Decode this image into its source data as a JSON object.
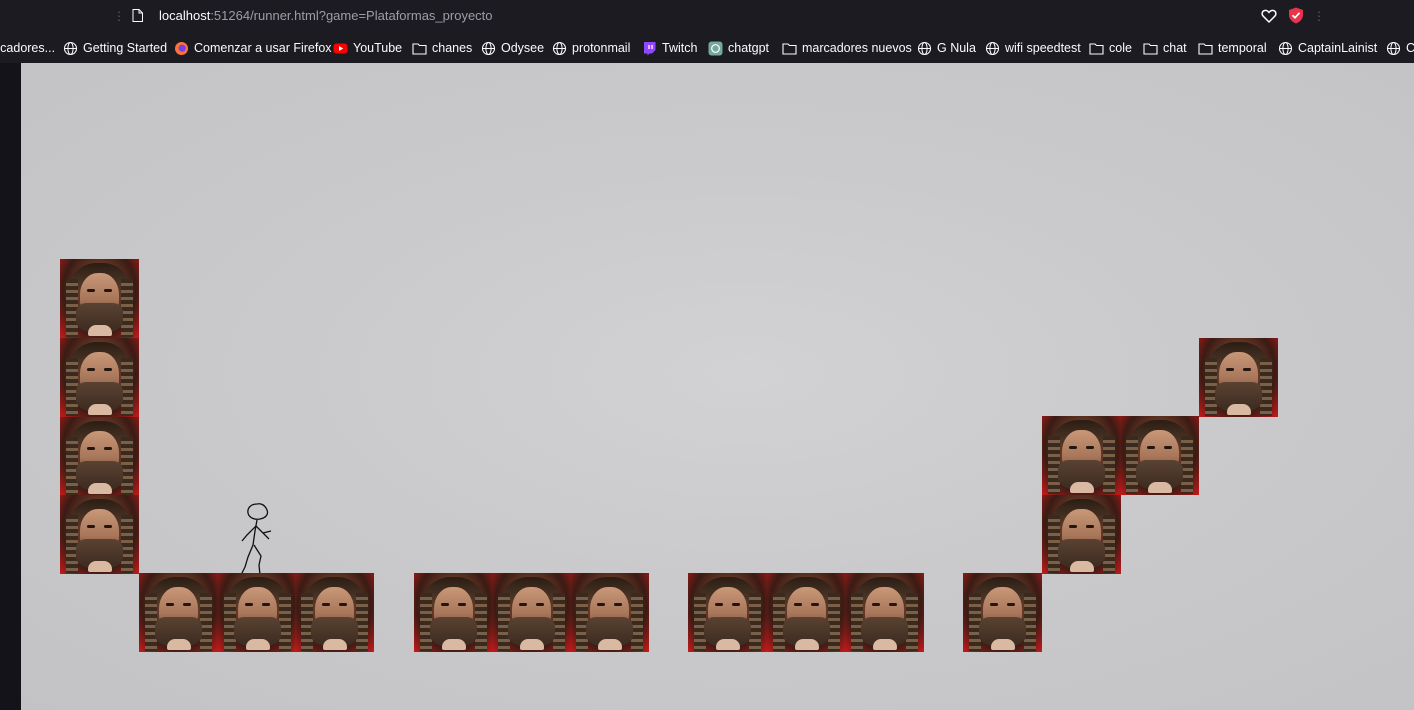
{
  "browser": {
    "url_host": "localhost",
    "url_rest": ":51264/runner.html?game=Plataformas_proyecto",
    "bookmarks": [
      {
        "label": "rcadores...",
        "icon": "folder-icon"
      },
      {
        "label": "Getting Started",
        "icon": "globe-icon"
      },
      {
        "label": "Comenzar a usar Firefox",
        "icon": "firefox-icon"
      },
      {
        "label": "YouTube",
        "icon": "youtube-icon"
      },
      {
        "label": "chanes",
        "icon": "folder-icon"
      },
      {
        "label": "Odysee",
        "icon": "globe-icon"
      },
      {
        "label": "protonmail",
        "icon": "globe-icon"
      },
      {
        "label": "Twitch",
        "icon": "twitch-icon"
      },
      {
        "label": "chatgpt",
        "icon": "chatgpt-icon"
      },
      {
        "label": "marcadores nuevos",
        "icon": "folder-icon"
      },
      {
        "label": "G Nula",
        "icon": "globe-icon"
      },
      {
        "label": "wifi speedtest",
        "icon": "globe-icon"
      },
      {
        "label": "cole",
        "icon": "folder-icon"
      },
      {
        "label": "chat",
        "icon": "folder-icon"
      },
      {
        "label": "temporal",
        "icon": "folder-icon"
      },
      {
        "label": "CaptainLainist",
        "icon": "globe-icon"
      },
      {
        "label": "C",
        "icon": "globe-icon"
      }
    ]
  },
  "game": {
    "title": "Plataformas_proyecto",
    "tile_sprite": "bearded-face-tile",
    "player_sprite": "stick-figure"
  }
}
